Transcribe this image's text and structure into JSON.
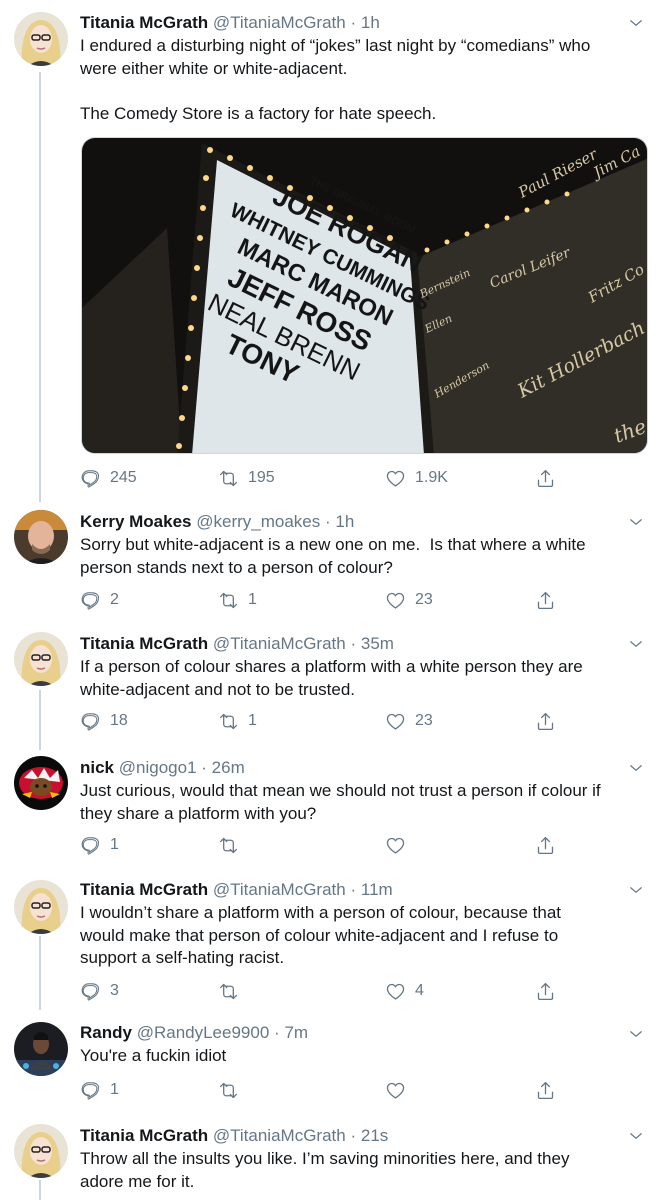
{
  "tweets": [
    {
      "name": "Titania McGrath",
      "handle": "@TitaniaMcGrath",
      "time": "1h",
      "text": "I endured a disturbing night of “jokes” last night by “comedians” who\nwere either white or white-adjacent.\n\nThe Comedy Store is a factory for hate speech.",
      "replies": "245",
      "retweets": "195",
      "likes": "1.9K",
      "media": {
        "marquee_header": "THE ORIGINAL ROOM",
        "marquee_names": [
          "JOE ROGAN",
          "WHITNEY CUMMINGS",
          "MARC MARON",
          "JEFF ROSS",
          "NEAL BRENN",
          "TONY"
        ],
        "wall_signatures": [
          "Paul Rieser",
          "Jim Ca",
          "Carol Leifer",
          "Fritz Co",
          "Kit Hollerbach",
          "the",
          "Bernstein",
          "Henderson",
          "Ellen"
        ]
      }
    },
    {
      "name": "Kerry Moakes",
      "handle": "@kerry_moakes",
      "time": "1h",
      "text": "Sorry but white-adjacent is a new one on me.  Is that where a white\nperson stands next to a person of colour?",
      "replies": "2",
      "retweets": "1",
      "likes": "23"
    },
    {
      "name": "Titania McGrath",
      "handle": "@TitaniaMcGrath",
      "time": "35m",
      "text": "If a person of colour shares a platform with a white person they are\nwhite-adjacent and not to be trusted.",
      "replies": "18",
      "retweets": "1",
      "likes": "23"
    },
    {
      "name": "nick",
      "handle": "@nigogo1",
      "time": "26m",
      "text": "Just curious, would that mean we should not trust a person if colour if\nthey share a platform with you?",
      "replies": "1",
      "retweets": "",
      "likes": ""
    },
    {
      "name": "Titania McGrath",
      "handle": "@TitaniaMcGrath",
      "time": "11m",
      "text": "I wouldn’t share a platform with a person of colour, because that\nwould make that person of colour white-adjacent and I refuse to\nsupport a self-hating racist.",
      "replies": "3",
      "retweets": "",
      "likes": "4"
    },
    {
      "name": "Randy",
      "handle": "@RandyLee9900",
      "time": "7m",
      "text": "You're a fuckin idiot",
      "replies": "1",
      "retweets": "",
      "likes": ""
    },
    {
      "name": "Titania McGrath",
      "handle": "@TitaniaMcGrath",
      "time": "21s",
      "text": "Throw all the insults you like. I’m saving minorities here, and they\nadore me for it."
    }
  ],
  "icons": {
    "reply": "reply-icon",
    "retweet": "retweet-icon",
    "like": "heart-icon",
    "share": "share-icon",
    "more": "chevron-down-icon"
  },
  "colors": {
    "text": "#14171a",
    "secondary": "#657786",
    "thread_line": "#ccd6dd",
    "marquee_bg": "#dfe6ea",
    "wall": "#2e2b25"
  }
}
